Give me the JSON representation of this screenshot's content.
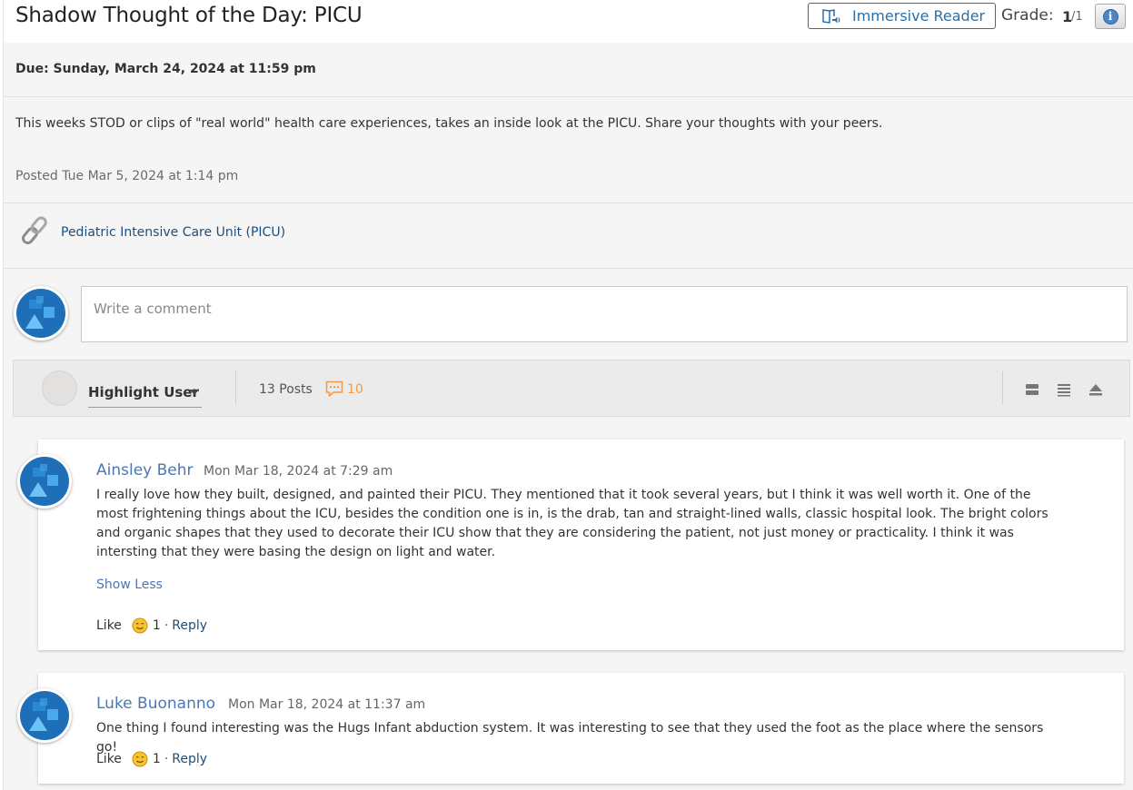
{
  "header": {
    "title": "Shadow Thought of the Day: PICU",
    "immersive_reader_label": "Immersive Reader",
    "grade_label": "Grade:",
    "grade_value": "1",
    "grade_max": "/1",
    "info_glyph": "i"
  },
  "assignment": {
    "due": "Due: Sunday, March 24, 2024 at 11:59 pm",
    "description": "This weeks STOD or clips of \"real world\" health care experiences, takes an inside look at the PICU. Share your thoughts with your peers.",
    "posted": "Posted Tue Mar 5, 2024 at 1:14 pm",
    "link_text": "Pediatric Intensive Care Unit (PICU)"
  },
  "comment_box": {
    "placeholder": "Write a comment"
  },
  "toolbar": {
    "highlight_user_label": "Highlight User",
    "posts_count": "13 Posts",
    "messages_count": "10"
  },
  "posts": [
    {
      "author": "Ainsley Behr",
      "date": "Mon Mar 18, 2024 at 7:29 am",
      "body": "I really love how they built, designed, and painted their PICU. They mentioned that it took several years, but I think it was well worth it. One of the most frightening things about the ICU, besides the condition one is in, is the drab, tan and straight-lined walls, classic hospital look. The bright colors and organic shapes that they used to decorate their ICU show that they are considering the patient, not just money or practicality. I think it was intersting that they were basing the design on light and water.",
      "show_less": "Show Less",
      "like_label": "Like",
      "like_count": "1",
      "reply_label": "Reply"
    },
    {
      "author": "Luke Buonanno",
      "date": "Mon Mar 18, 2024 at 11:37 am",
      "body": "One thing I found interesting was the Hugs Infant abduction system. It was interesting to see that they used the foot as the place where the sensors go!",
      "like_label": "Like",
      "like_count": "1",
      "reply_label": "Reply"
    }
  ],
  "icons": {
    "immersive_reader": "immersive-reader-icon",
    "info": "info-icon",
    "link": "chain-link-icon",
    "messages": "speech-bubble-icon",
    "views": [
      "expanded-view-icon",
      "list-view-icon",
      "collapse-all-icon"
    ],
    "smiley": "smiley-icon"
  },
  "colors": {
    "accent_blue": "#2a6fa8",
    "author_blue": "#4b77b4",
    "link_blue": "#1f4e79",
    "unread_orange": "#f39a4b"
  }
}
